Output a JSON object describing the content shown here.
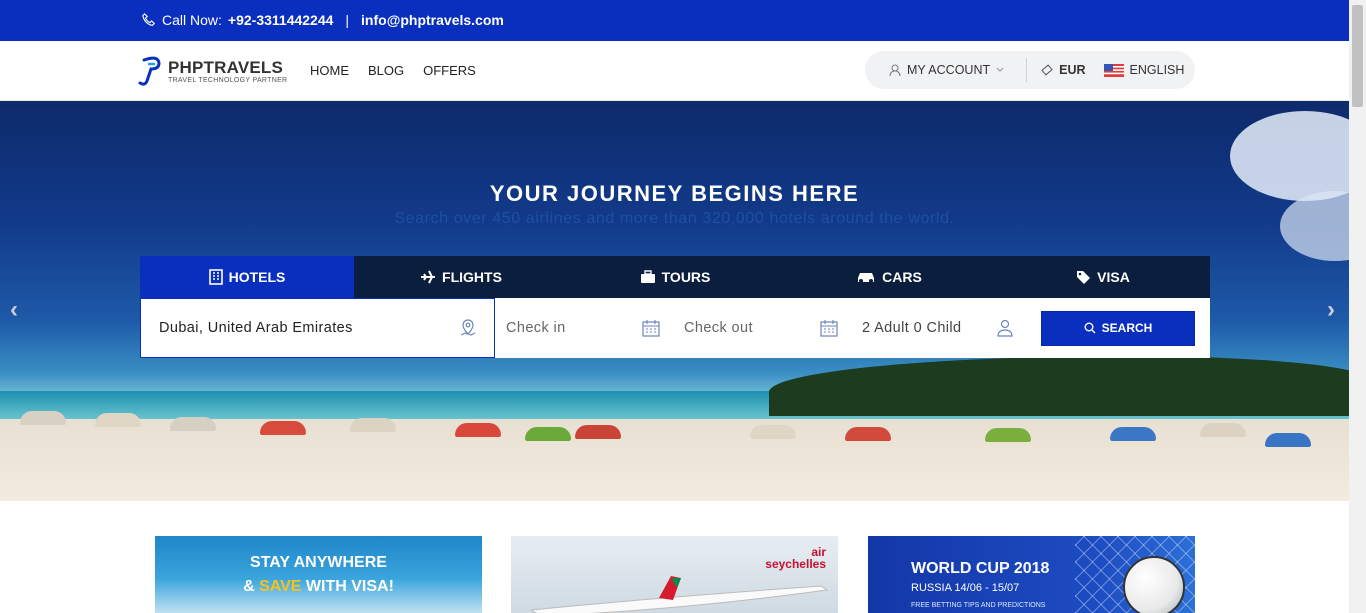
{
  "topbar": {
    "call_label": "Call Now:",
    "phone": "+92-3311442244",
    "separator": "|",
    "email": "info@phptravels.com"
  },
  "navbar": {
    "logo_title": "PHPTRAVELS",
    "logo_subtitle": "TRAVEL TECHNOLOGY PARTNER",
    "links": [
      "HOME",
      "BLOG",
      "OFFERS"
    ],
    "account_label": "MY ACCOUNT",
    "currency": "EUR",
    "language": "ENGLISH"
  },
  "hero": {
    "title": "YOUR JOURNEY BEGINS HERE",
    "subtitle": "Search over 450 airlines and more than 320,000 hotels around the world.",
    "prev_arrow": "‹",
    "next_arrow": "›"
  },
  "search": {
    "tabs": [
      {
        "label": "HOTELS",
        "icon": "building-icon",
        "active": true
      },
      {
        "label": "FLIGHTS",
        "icon": "plane-icon",
        "active": false
      },
      {
        "label": "TOURS",
        "icon": "suitcase-icon",
        "active": false
      },
      {
        "label": "CARS",
        "icon": "car-icon",
        "active": false
      },
      {
        "label": "VISA",
        "icon": "tag-icon",
        "active": false
      }
    ],
    "destination": "Dubai, United Arab Emirates",
    "checkin_placeholder": "Check in",
    "checkout_placeholder": "Check out",
    "guests": "2 Adult 0 Child",
    "button_label": "SEARCH"
  },
  "promos": {
    "visa_line1": "STAY ANYWHERE",
    "visa_line2_a": "& ",
    "visa_line2_highlight": "SAVE",
    "visa_line2_b": " WITH VISA!",
    "airline_brand_1": "air",
    "airline_brand_2": "seychelles",
    "worldcup_title": "WORLD CUP 2018",
    "worldcup_dates": "RUSSIA 14/06 - 15/07",
    "worldcup_small": "FREE BETTING TIPS AND PREDICTIONS"
  },
  "colors": {
    "brand_blue": "#0a2fbe",
    "tab_bar": "#0c1e3e",
    "highlight_yellow": "#f6c21b"
  }
}
